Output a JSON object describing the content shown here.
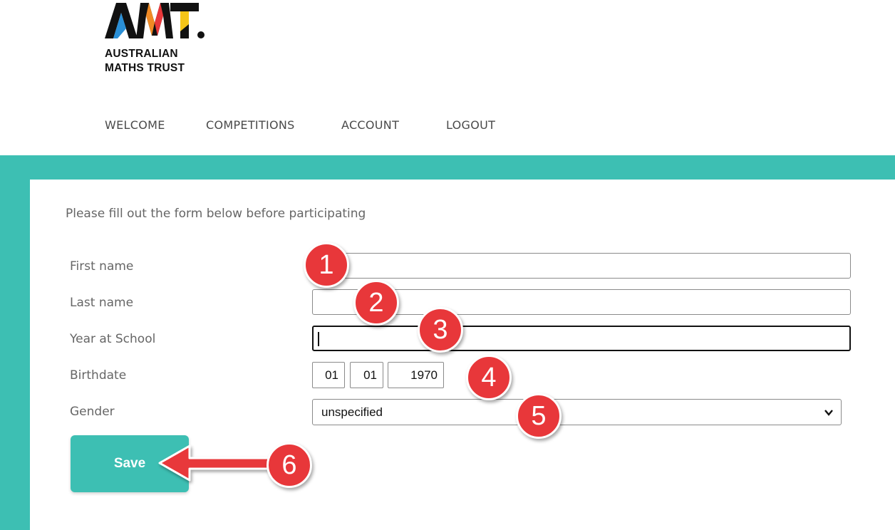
{
  "brand": {
    "logo_text": "AMT.",
    "line1": "AUSTRALIAN",
    "line2": "MATHS TRUST",
    "colors": {
      "teal": "#3dbfb3",
      "dark": "#111111",
      "yellow": "#f5c518",
      "orange": "#f08a24",
      "red": "#e8373a",
      "blue": "#2a8fd6"
    }
  },
  "nav": {
    "items": [
      {
        "label": "WELCOME"
      },
      {
        "label": "COMPETITIONS"
      },
      {
        "label": "ACCOUNT"
      },
      {
        "label": "LOGOUT"
      }
    ]
  },
  "form": {
    "intro": "Please fill out the form below before participating",
    "first_name": {
      "label": "First name",
      "value": ""
    },
    "last_name": {
      "label": "Last name",
      "value": ""
    },
    "year_at_school": {
      "label": "Year at School",
      "value": ""
    },
    "birthdate": {
      "label": "Birthdate",
      "day": "01",
      "month": "01",
      "year": "1970"
    },
    "gender": {
      "label": "Gender",
      "selected": "unspecified"
    },
    "save_label": "Save"
  },
  "callouts": [
    "1",
    "2",
    "3",
    "4",
    "5",
    "6"
  ],
  "theme": {
    "accent": "#3dbfb3",
    "callout": "#e8373a"
  }
}
